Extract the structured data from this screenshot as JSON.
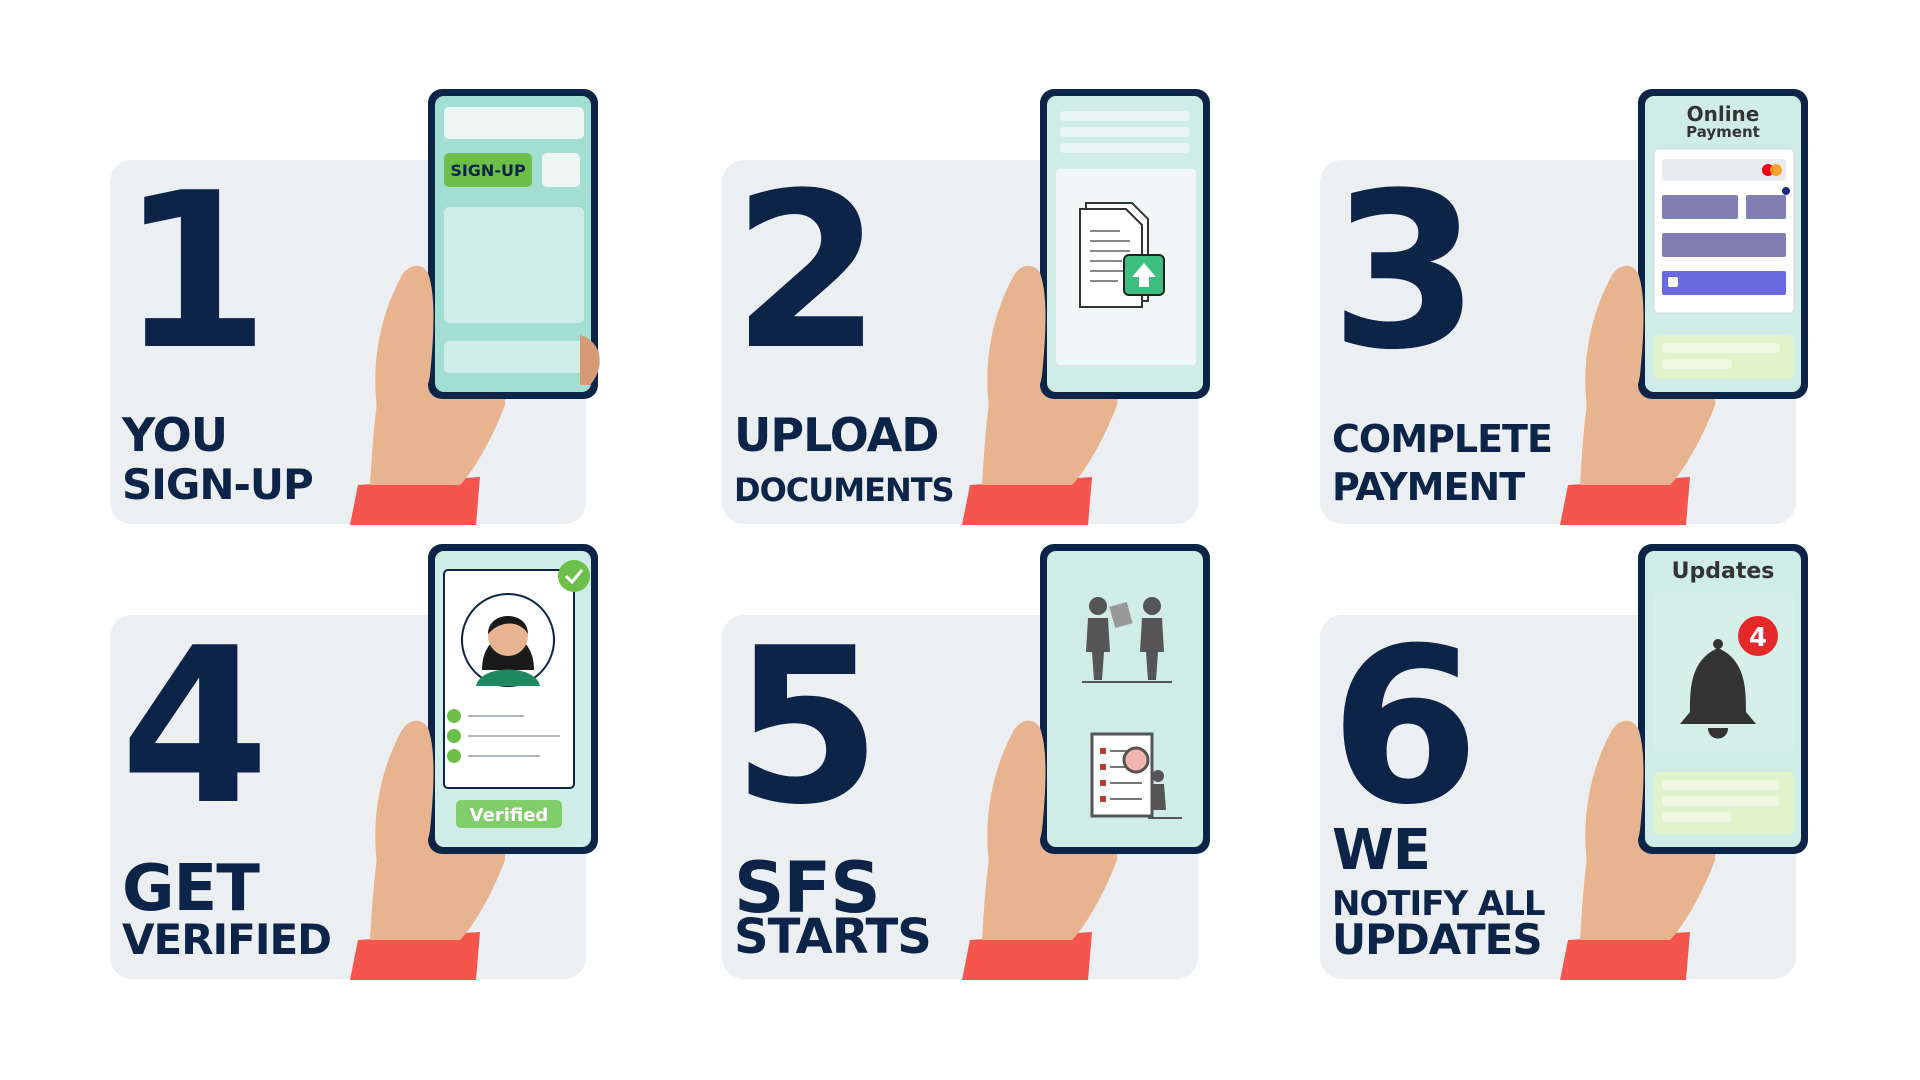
{
  "colors": {
    "navy": "#0b2447",
    "card_bg": "#eceff2",
    "screen_teal": "#a3ded3",
    "skin": "#e8b48f",
    "skin_shadow": "#d79a74",
    "sleeve": "#f4564e",
    "green": "#6cc04a",
    "purple": "#7f7fb2",
    "red_badge": "#e52829"
  },
  "steps": [
    {
      "number": "1",
      "line1": "YOU",
      "line2": "SIGN-UP",
      "screen": {
        "button_label": "SIGN-UP"
      }
    },
    {
      "number": "2",
      "line1": "UPLOAD",
      "line2": "DOCUMENTS",
      "screen": {
        "icon": "document-upload-icon"
      }
    },
    {
      "number": "3",
      "line1": "COMPLETE",
      "line2": "PAYMENT",
      "screen": {
        "title_line1": "Online",
        "title_line2": "Payment"
      }
    },
    {
      "number": "4",
      "line1": "GET",
      "line2": "VERIFIED",
      "screen": {
        "badge_label": "Verified"
      }
    },
    {
      "number": "5",
      "line1": "SFS",
      "line2": "STARTS",
      "screen": {
        "icon": "consultation-icon"
      }
    },
    {
      "number": "6",
      "line1": "WE",
      "line2": "NOTIFY ALL",
      "line3": "UPDATES",
      "screen": {
        "title": "Updates",
        "badge_count": "4"
      }
    }
  ]
}
